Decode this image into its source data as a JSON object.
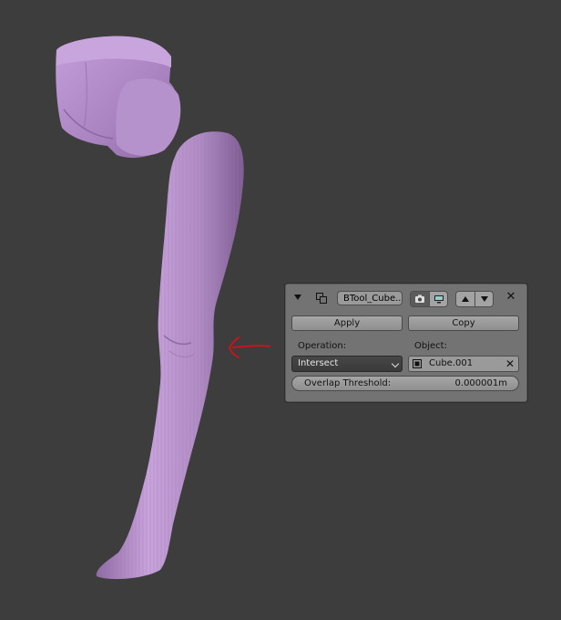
{
  "viewport": {
    "background": "#3d3d3d",
    "mesh_color": "#b28dc6",
    "annotation_color": "#d0121a"
  },
  "modifier": {
    "name": "BTool_Cube...",
    "apply_label": "Apply",
    "copy_label": "Copy",
    "operation_label": "Operation:",
    "operation_value": "Intersect",
    "object_label": "Object:",
    "object_value": "Cube.001",
    "threshold_label": "Overlap Threshold:",
    "threshold_value": "0.000001m",
    "icons": [
      "collapse-arrow-icon",
      "boolean-modifier-icon",
      "camera-icon",
      "display-icon",
      "move-up-icon",
      "move-down-icon",
      "close-icon",
      "mesh-object-icon",
      "clear-icon"
    ]
  }
}
